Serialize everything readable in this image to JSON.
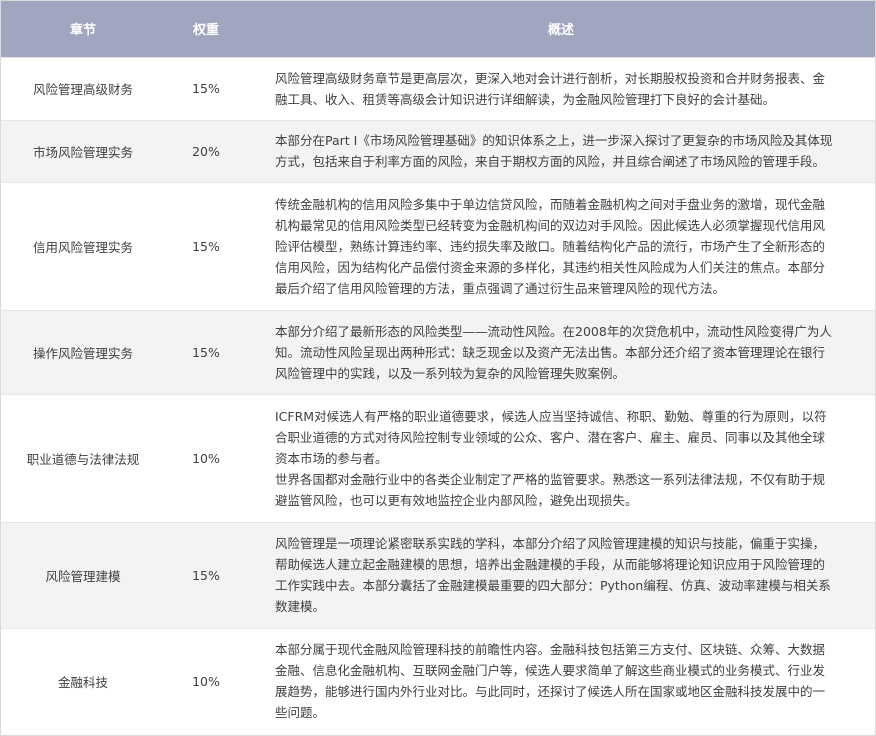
{
  "headers": {
    "chapter": "章节",
    "weight": "权重",
    "overview": "概述"
  },
  "rows": [
    {
      "chapter": "风险管理高级财务",
      "weight": "15%",
      "overview": [
        "风险管理高级财务章节是更高层次，更深入地对会计进行剖析，对长期股权投资和合并财务报表、金融工具、收入、租赁等高级会计知识进行详细解读，为金融风险管理打下良好的会计基础。"
      ]
    },
    {
      "chapter": "市场风险管理实务",
      "weight": "20%",
      "overview": [
        "本部分在Part I《市场风险管理基础》的知识体系之上，进一步深入探讨了更复杂的市场风险及其体现方式，包括来自于利率方面的风险，来自于期权方面的风险，并且综合阐述了市场风险的管理手段。"
      ]
    },
    {
      "chapter": "信用风险管理实务",
      "weight": "15%",
      "overview": [
        "传统金融机构的信用风险多集中于单边信贷风险，而随着金融机构之间对手盘业务的激增，现代金融机构最常见的信用风险类型已经转变为金融机构间的双边对手风险。因此候选人必须掌握现代信用风险评估模型，熟练计算违约率、违约损失率及敞口。随着结构化产品的流行，市场产生了全新形态的信用风险，因为结构化产品偿付资金来源的多样化，其违约相关性风险成为人们关注的焦点。本部分最后介绍了信用风险管理的方法，重点强调了通过衍生品来管理风险的现代方法。"
      ]
    },
    {
      "chapter": "操作风险管理实务",
      "weight": "15%",
      "overview": [
        "本部分介绍了最新形态的风险类型——流动性风险。在2008年的次贷危机中，流动性风险变得广为人知。流动性风险呈现出两种形式：缺乏现金以及资产无法出售。本部分还介绍了资本管理理论在银行风险管理中的实践，以及一系列较为复杂的风险管理失败案例。"
      ]
    },
    {
      "chapter": "职业道德与法律法规",
      "weight": "10%",
      "overview": [
        "ICFRM对候选人有严格的职业道德要求，候选人应当坚持诚信、称职、勤勉、尊重的行为原则，以符合职业道德的方式对待风险控制专业领域的公众、客户、潜在客户、雇主、雇员、同事以及其他全球资本市场的参与者。",
        "世界各国都对金融行业中的各类企业制定了严格的监管要求。熟悉这一系列法律法规，不仅有助于规避监管风险，也可以更有效地监控企业内部风险，避免出现损失。"
      ]
    },
    {
      "chapter": "风险管理建模",
      "weight": "15%",
      "overview": [
        "风险管理是一项理论紧密联系实践的学科，本部分介绍了风险管理建模的知识与技能，偏重于实操，帮助候选人建立起金融建模的思想，培养出金融建模的手段，从而能够将理论知识应用于风险管理的工作实践中去。本部分囊括了金融建模最重要的四大部分：Python编程、仿真、波动率建模与相关系数建模。"
      ]
    },
    {
      "chapter": "金融科技",
      "weight": "10%",
      "overview": [
        "本部分属于现代金融风险管理科技的前瞻性内容。金融科技包括第三方支付、区块链、众筹、大数据金融、信息化金融机构、互联网金融门户等，候选人要求简单了解这些商业模式的业务模式、行业发展趋势，能够进行国内外行业对比。与此同时，还探讨了候选人所在国家或地区金融科技发展中的一些问题。"
      ]
    }
  ]
}
